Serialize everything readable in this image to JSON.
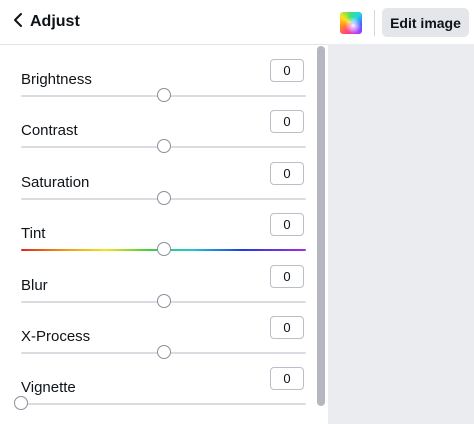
{
  "header": {
    "title": "Adjust",
    "back_icon": "chevron-left-icon"
  },
  "toolbar": {
    "swatch_icon": "color-swatch-icon",
    "edit_label": "Edit image"
  },
  "adjustments": [
    {
      "label": "Brightness",
      "value": "0",
      "slider_fraction": 0.5,
      "track": "plain"
    },
    {
      "label": "Contrast",
      "value": "0",
      "slider_fraction": 0.5,
      "track": "plain"
    },
    {
      "label": "Saturation",
      "value": "0",
      "slider_fraction": 0.5,
      "track": "plain"
    },
    {
      "label": "Tint",
      "value": "0",
      "slider_fraction": 0.5,
      "track": "rainbow"
    },
    {
      "label": "Blur",
      "value": "0",
      "slider_fraction": 0.5,
      "track": "plain"
    },
    {
      "label": "X-Process",
      "value": "0",
      "slider_fraction": 0.5,
      "track": "plain"
    },
    {
      "label": "Vignette",
      "value": "0",
      "slider_fraction": 0.0,
      "track": "plain"
    }
  ]
}
